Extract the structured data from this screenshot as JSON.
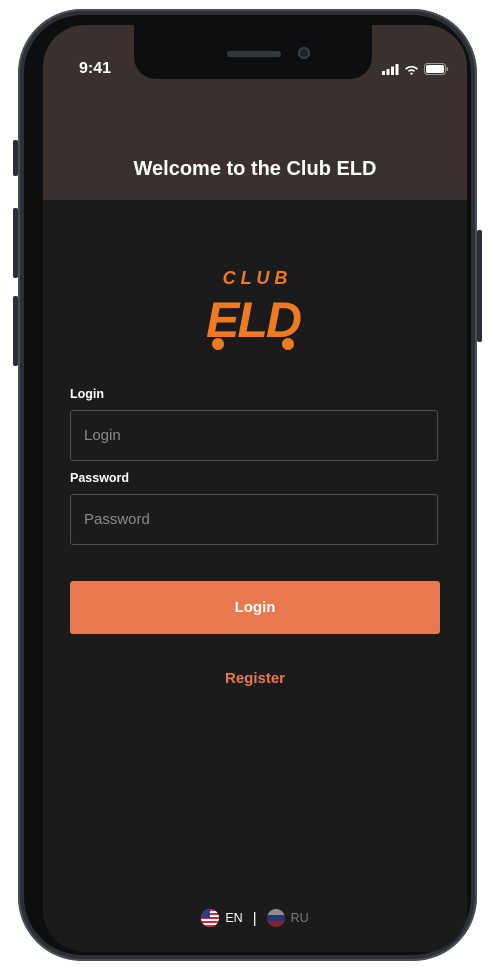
{
  "status_bar": {
    "time": "9:41"
  },
  "header": {
    "title": "Welcome to the Club ELD"
  },
  "logo": {
    "top_text": "C L U B",
    "bottom_text": "ELD"
  },
  "form": {
    "login_label": "Login",
    "login_placeholder": "Login",
    "password_label": "Password",
    "password_placeholder": "Password",
    "submit_label": "Login",
    "register_label": "Register"
  },
  "languages": [
    {
      "code": "EN",
      "active": true,
      "icon": "us-flag-icon"
    },
    {
      "code": "RU",
      "active": false,
      "icon": "ru-flag-icon"
    }
  ],
  "colors": {
    "accent": "#e8784e",
    "logo_orange": "#f07a22",
    "header_bg": "#3a302d",
    "screen_bg": "#1b1b1c"
  }
}
